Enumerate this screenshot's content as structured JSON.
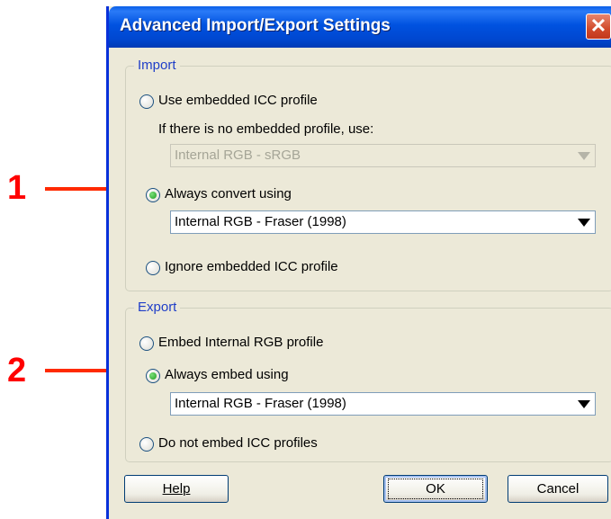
{
  "dialog": {
    "title": "Advanced Import/Export Settings",
    "close_glyph": "✕"
  },
  "import": {
    "legend": "Import",
    "use_embedded_label": "Use embedded ICC profile",
    "no_embedded_hint": "If there is no embedded profile, use:",
    "fallback_select_value": "Internal RGB - sRGB",
    "always_convert_label": "Always convert using",
    "convert_select_value": "Internal RGB - Fraser (1998)",
    "ignore_label": "Ignore embedded ICC profile",
    "selected": "always_convert"
  },
  "export": {
    "legend": "Export",
    "embed_internal_label": "Embed Internal RGB profile",
    "always_embed_label": "Always embed using",
    "embed_select_value": "Internal RGB - Fraser (1998)",
    "do_not_embed_label": "Do not embed ICC profiles",
    "selected": "always_embed"
  },
  "buttons": {
    "help": "Help",
    "ok": "OK",
    "cancel": "Cancel"
  },
  "annotations": {
    "marker_1": "1",
    "marker_2": "2"
  },
  "colors": {
    "title_bar": "#0054e3",
    "close_button": "#d14a2b",
    "group_legend": "#1f3ec8",
    "annotation_red": "#ff2a00",
    "radio_selected": "#1e9c1e"
  },
  "icons": [
    "close-icon",
    "dropdown-arrow-icon",
    "annotation-arrow-icon"
  ]
}
